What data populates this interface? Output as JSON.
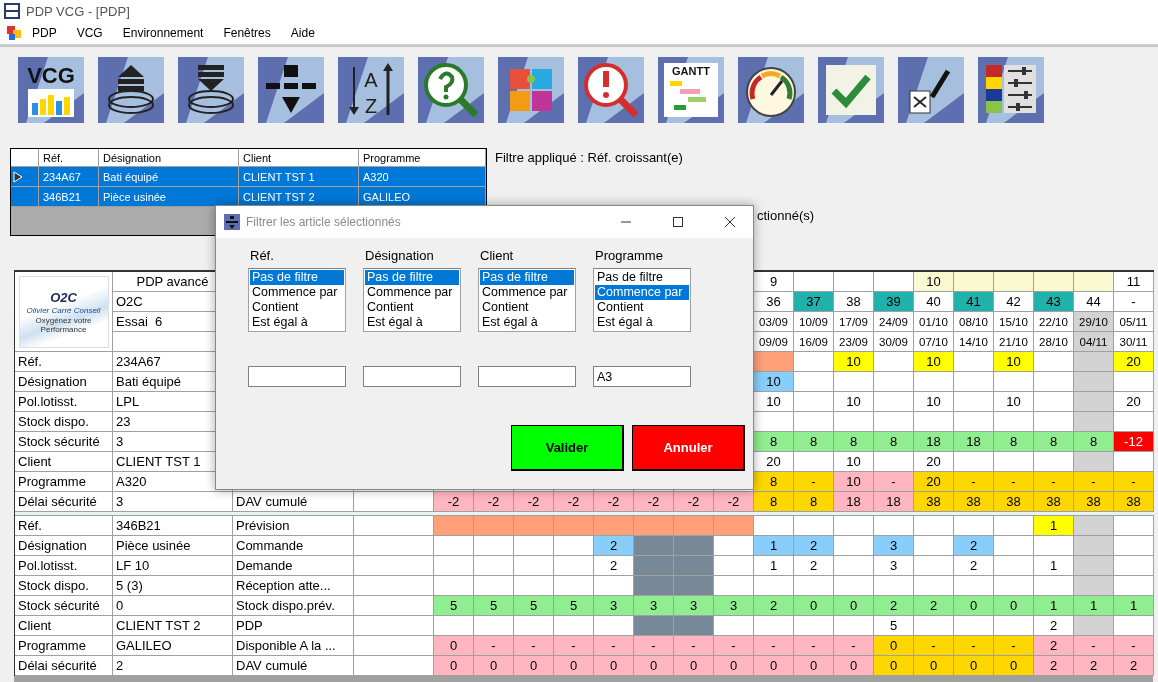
{
  "window": {
    "title": "PDP VCG - [PDP]"
  },
  "menu": [
    {
      "label": "PDP"
    },
    {
      "label": "VCG"
    },
    {
      "label": "Environnement"
    },
    {
      "label": "Fenêtres"
    },
    {
      "label": "Aide"
    }
  ],
  "toolbar": [
    {
      "kind": "vcg",
      "label": "VCG"
    },
    {
      "kind": "stack_up"
    },
    {
      "kind": "stack_down"
    },
    {
      "kind": "filter"
    },
    {
      "kind": "sort",
      "letters": [
        "A",
        "Z"
      ]
    },
    {
      "kind": "search_question"
    },
    {
      "kind": "puzzle"
    },
    {
      "kind": "search_alert"
    },
    {
      "kind": "gantt",
      "label": "GANTT"
    },
    {
      "kind": "gauge"
    },
    {
      "kind": "check"
    },
    {
      "kind": "excel"
    },
    {
      "kind": "settings"
    }
  ],
  "selection_table": {
    "columns": [
      "Réf.",
      "Désignation",
      "Client",
      "Programme"
    ],
    "rows": [
      {
        "cells": [
          "234A67",
          "Bati équipé",
          "CLIENT TST 1",
          "A320"
        ],
        "selected": true,
        "current": true
      },
      {
        "cells": [
          "346B21",
          "Pièce usinée",
          "CLIENT TST 2",
          "GALILEO"
        ],
        "selected": true,
        "current": false
      }
    ]
  },
  "filter_status": "Filtre appliqué : Réf. croissant(e)",
  "selection_count": "ctionné(s)",
  "planning": {
    "logo": {
      "mark": "O2C",
      "name": "Olivier Carré Conseil",
      "tagline": "Oxygénez votre Performance"
    },
    "header_values": [
      "PDP avancé",
      "O2C",
      "Essai  6"
    ],
    "period_rows": [
      [
        null,
        null,
        null,
        null,
        null,
        null,
        null,
        null,
        {
          "text": "9"
        },
        {},
        {},
        {},
        {
          "text": "10",
          "color": "#fafad2"
        },
        {
          "color": "#fafad2"
        },
        {
          "color": "#fafad2"
        },
        {
          "color": "#fafad2"
        },
        {
          "color": "#fafad2"
        },
        {
          "text": "11"
        }
      ],
      [
        null,
        null,
        null,
        null,
        null,
        null,
        null,
        null,
        {
          "text": "36"
        },
        {
          "text": "37",
          "color": "#20b2aa"
        },
        {
          "text": "38"
        },
        {
          "text": "39",
          "color": "#20b2aa"
        },
        {
          "text": "40"
        },
        {
          "text": "41",
          "color": "#20b2aa"
        },
        {
          "text": "42"
        },
        {
          "text": "43",
          "color": "#20b2aa"
        },
        {
          "text": "44"
        },
        {
          "text": "-"
        }
      ],
      [
        null,
        null,
        null,
        null,
        null,
        null,
        null,
        null,
        {
          "text": "03/09"
        },
        {
          "text": "10/09"
        },
        {
          "text": "17/09"
        },
        {
          "text": "24/09"
        },
        {
          "text": "01/10"
        },
        {
          "text": "08/10"
        },
        {
          "text": "15/10"
        },
        {
          "text": "22/10"
        },
        {
          "text": "29/10",
          "color": "#d3d3d3"
        },
        {
          "text": "05/11"
        }
      ],
      [
        null,
        null,
        null,
        null,
        null,
        null,
        null,
        null,
        {
          "text": "09/09"
        },
        {
          "text": "16/09"
        },
        {
          "text": "23/09"
        },
        {
          "text": "30/09"
        },
        {
          "text": "07/10"
        },
        {
          "text": "14/10"
        },
        {
          "text": "21/10"
        },
        {
          "text": "28/10"
        },
        {
          "text": "04/11",
          "color": "#d3d3d3"
        },
        {
          "text": "30/11"
        }
      ]
    ],
    "articles": [
      {
        "rows": [
          {
            "label": "Réf.",
            "value": "234A67",
            "cells": [
              null,
              null,
              null,
              null,
              null,
              null,
              null,
              null,
              {
                "color": "#ffa07a"
              },
              {},
              {
                "text": "10",
                "color": "#ffff00"
              },
              {},
              {
                "text": "10",
                "color": "#ffff00"
              },
              {},
              {
                "text": "10",
                "color": "#ffff00"
              },
              {},
              {
                "color": "#d3d3d3"
              },
              {
                "text": "20",
                "color": "#ffff00"
              }
            ]
          },
          {
            "label": "Désignation",
            "value": "Bati équipé",
            "cells": [
              null,
              null,
              null,
              null,
              null,
              null,
              null,
              null,
              {
                "text": "10",
                "color": "#87cefa"
              },
              {},
              {},
              {},
              {},
              {},
              {},
              {},
              {
                "color": "#d3d3d3"
              },
              {}
            ]
          },
          {
            "label": "Pol.lotisst.",
            "value": "LPL",
            "cells": [
              null,
              null,
              null,
              null,
              null,
              null,
              null,
              null,
              {
                "text": "10"
              },
              {},
              {
                "text": "10"
              },
              {},
              {
                "text": "10"
              },
              {},
              {
                "text": "10"
              },
              {},
              {
                "color": "#d3d3d3"
              },
              {
                "text": "20"
              }
            ]
          },
          {
            "label": "Stock dispo.",
            "value": "23",
            "cells": [
              null,
              null,
              null,
              null,
              null,
              null,
              null,
              null,
              {},
              {},
              {},
              {},
              {},
              {},
              {},
              {},
              {
                "color": "#d3d3d3"
              },
              {}
            ]
          },
          {
            "label": "Stock sécurité",
            "value": "3",
            "cells": [
              null,
              null,
              null,
              null,
              null,
              null,
              null,
              null,
              {
                "text": "8",
                "color": "#90ee90"
              },
              {
                "text": "8",
                "color": "#90ee90"
              },
              {
                "text": "8",
                "color": "#90ee90"
              },
              {
                "text": "8",
                "color": "#90ee90"
              },
              {
                "text": "18",
                "color": "#90ee90"
              },
              {
                "text": "18",
                "color": "#90ee90"
              },
              {
                "text": "8",
                "color": "#90ee90"
              },
              {
                "text": "8",
                "color": "#90ee90"
              },
              {
                "text": "8",
                "color": "#90ee90"
              },
              {
                "text": "-12",
                "color": "#ff0000"
              }
            ]
          },
          {
            "label": "Client",
            "value": "CLIENT TST 1",
            "cells": [
              null,
              null,
              null,
              null,
              null,
              null,
              null,
              null,
              {
                "text": "20"
              },
              {},
              {
                "text": "10"
              },
              {},
              {
                "text": "20"
              },
              {},
              {},
              {},
              {
                "color": "#d3d3d3"
              },
              {}
            ]
          },
          {
            "label": "Programme",
            "value": "A320",
            "cells": [
              null,
              null,
              null,
              null,
              null,
              null,
              null,
              null,
              {
                "text": "8",
                "color": "#ffd700"
              },
              {
                "text": "-",
                "color": "#ffd700"
              },
              {
                "text": "10",
                "color": "#ffb6c1"
              },
              {
                "text": "-",
                "color": "#ffb6c1"
              },
              {
                "text": "20",
                "color": "#ffd700"
              },
              {
                "text": "-",
                "color": "#ffd700"
              },
              {
                "text": "-",
                "color": "#ffd700"
              },
              {
                "text": "-",
                "color": "#ffd700"
              },
              {
                "text": "-",
                "color": "#ffd700"
              },
              {
                "text": "-",
                "color": "#ffd700"
              }
            ]
          },
          {
            "label": "Délai sécurité",
            "value": "3",
            "measure": "DAV cumulé",
            "cells": [
              {
                "text": "-2",
                "color": "#ffb6c1"
              },
              {
                "text": "-2",
                "color": "#ffb6c1"
              },
              {
                "text": "-2",
                "color": "#ffb6c1"
              },
              {
                "text": "-2",
                "color": "#ffb6c1"
              },
              {
                "text": "-2",
                "color": "#ffb6c1"
              },
              {
                "text": "-2",
                "color": "#ffb6c1"
              },
              {
                "text": "-2",
                "color": "#ffb6c1"
              },
              {
                "text": "-2",
                "color": "#ffb6c1"
              },
              {
                "text": "8",
                "color": "#ffd700"
              },
              {
                "text": "8",
                "color": "#ffd700"
              },
              {
                "text": "18",
                "color": "#ffb6c1"
              },
              {
                "text": "18",
                "color": "#ffb6c1"
              },
              {
                "text": "38",
                "color": "#ffd700"
              },
              {
                "text": "38",
                "color": "#ffd700"
              },
              {
                "text": "38",
                "color": "#ffd700"
              },
              {
                "text": "38",
                "color": "#ffd700"
              },
              {
                "text": "38",
                "color": "#ffd700"
              },
              {
                "text": "38",
                "color": "#ffd700"
              }
            ]
          }
        ]
      },
      {
        "rows": [
          {
            "label": "Réf.",
            "value": "346B21",
            "measure": "Prévision",
            "cells": [
              {
                "color": "#ffa07a"
              },
              {
                "color": "#ffa07a"
              },
              {
                "color": "#ffa07a"
              },
              {
                "color": "#ffa07a"
              },
              {
                "color": "#ffa07a"
              },
              {
                "color": "#ffa07a"
              },
              {
                "color": "#ffa07a"
              },
              {
                "color": "#ffa07a"
              },
              {},
              {},
              {},
              {},
              {},
              {},
              {},
              {
                "text": "1",
                "color": "#ffff00"
              },
              {
                "color": "#d3d3d3"
              },
              {}
            ]
          },
          {
            "label": "Désignation",
            "value": "Pièce usinée",
            "measure": "Commande",
            "cells": [
              {},
              {},
              {},
              {},
              {
                "text": "2",
                "color": "#87cefa"
              },
              {
                "color": "#778899"
              },
              {
                "color": "#778899"
              },
              {},
              {
                "text": "1",
                "color": "#87cefa"
              },
              {
                "text": "2",
                "color": "#87cefa"
              },
              {},
              {
                "text": "3",
                "color": "#87cefa"
              },
              {},
              {
                "text": "2",
                "color": "#87cefa"
              },
              {},
              {},
              {
                "color": "#d3d3d3"
              },
              {}
            ]
          },
          {
            "label": "Pol.lotisst.",
            "value": "LF 10",
            "measure": "Demande",
            "cells": [
              {},
              {},
              {},
              {},
              {
                "text": "2"
              },
              {
                "color": "#778899"
              },
              {
                "color": "#778899"
              },
              {},
              {
                "text": "1"
              },
              {
                "text": "2"
              },
              {},
              {
                "text": "3"
              },
              {},
              {
                "text": "2"
              },
              {},
              {
                "text": "1"
              },
              {
                "color": "#d3d3d3"
              },
              {}
            ]
          },
          {
            "label": "Stock dispo.",
            "value": "5 (3)",
            "measure": "Réception atte...",
            "cells": [
              {},
              {},
              {},
              {},
              {},
              {
                "color": "#778899"
              },
              {
                "color": "#778899"
              },
              {},
              {},
              {},
              {},
              {},
              {},
              {},
              {},
              {},
              {
                "color": "#d3d3d3"
              },
              {}
            ]
          },
          {
            "label": "Stock sécurité",
            "value": "0",
            "measure": "Stock dispo.prév.",
            "cells": [
              {
                "text": "5",
                "color": "#90ee90"
              },
              {
                "text": "5",
                "color": "#90ee90"
              },
              {
                "text": "5",
                "color": "#90ee90"
              },
              {
                "text": "5",
                "color": "#90ee90"
              },
              {
                "text": "3",
                "color": "#90ee90"
              },
              {
                "text": "3",
                "color": "#90ee90"
              },
              {
                "text": "3",
                "color": "#90ee90"
              },
              {
                "text": "3",
                "color": "#90ee90"
              },
              {
                "text": "2",
                "color": "#90ee90"
              },
              {
                "text": "0",
                "color": "#90ee90"
              },
              {
                "text": "0",
                "color": "#90ee90"
              },
              {
                "text": "2",
                "color": "#90ee90"
              },
              {
                "text": "2",
                "color": "#90ee90"
              },
              {
                "text": "0",
                "color": "#90ee90"
              },
              {
                "text": "0",
                "color": "#90ee90"
              },
              {
                "text": "1",
                "color": "#90ee90"
              },
              {
                "text": "1",
                "color": "#90ee90"
              },
              {
                "text": "1",
                "color": "#90ee90"
              }
            ]
          },
          {
            "label": "Client",
            "value": "CLIENT TST 2",
            "measure": "PDP",
            "cells": [
              {},
              {},
              {},
              {},
              {},
              {
                "color": "#778899"
              },
              {
                "color": "#778899"
              },
              {},
              {},
              {},
              {},
              {
                "text": "5"
              },
              {},
              {},
              {},
              {
                "text": "2"
              },
              {
                "color": "#d3d3d3"
              },
              {}
            ]
          },
          {
            "label": "Programme",
            "value": "GALILEO",
            "measure": "Disponible A la ...",
            "cells": [
              {
                "text": "0",
                "color": "#ffb6c1"
              },
              {
                "text": "-",
                "color": "#ffb6c1"
              },
              {
                "text": "-",
                "color": "#ffb6c1"
              },
              {
                "text": "-",
                "color": "#ffb6c1"
              },
              {
                "text": "-",
                "color": "#ffb6c1"
              },
              {
                "text": "-",
                "color": "#ffb6c1"
              },
              {
                "text": "-",
                "color": "#ffb6c1"
              },
              {
                "text": "-",
                "color": "#ffb6c1"
              },
              {
                "text": "-",
                "color": "#ffb6c1"
              },
              {
                "text": "-",
                "color": "#ffb6c1"
              },
              {
                "text": "-",
                "color": "#ffb6c1"
              },
              {
                "text": "0",
                "color": "#ffd700"
              },
              {
                "text": "-",
                "color": "#ffd700"
              },
              {
                "text": "-",
                "color": "#ffd700"
              },
              {
                "text": "-",
                "color": "#ffd700"
              },
              {
                "text": "2",
                "color": "#ffb6c1"
              },
              {
                "text": "-",
                "color": "#ffb6c1"
              },
              {
                "text": "-",
                "color": "#ffb6c1"
              }
            ]
          },
          {
            "label": "Délai sécurité",
            "value": "2",
            "measure": "DAV cumulé",
            "cells": [
              {
                "text": "0",
                "color": "#ffb6c1"
              },
              {
                "text": "0",
                "color": "#ffb6c1"
              },
              {
                "text": "0",
                "color": "#ffb6c1"
              },
              {
                "text": "0",
                "color": "#ffb6c1"
              },
              {
                "text": "0",
                "color": "#ffb6c1"
              },
              {
                "text": "0",
                "color": "#ffb6c1"
              },
              {
                "text": "0",
                "color": "#ffb6c1"
              },
              {
                "text": "0",
                "color": "#ffb6c1"
              },
              {
                "text": "0",
                "color": "#ffb6c1"
              },
              {
                "text": "0",
                "color": "#ffb6c1"
              },
              {
                "text": "0",
                "color": "#ffb6c1"
              },
              {
                "text": "0",
                "color": "#ffd700"
              },
              {
                "text": "0",
                "color": "#ffd700"
              },
              {
                "text": "0",
                "color": "#ffd700"
              },
              {
                "text": "0",
                "color": "#ffd700"
              },
              {
                "text": "2",
                "color": "#ffb6c1"
              },
              {
                "text": "2",
                "color": "#ffb6c1"
              },
              {
                "text": "2",
                "color": "#ffb6c1"
              }
            ]
          }
        ]
      }
    ]
  },
  "dialog": {
    "title": "Filtrer les article sélectionnés",
    "filters": [
      {
        "label": "Réf.",
        "options": [
          {
            "text": "Pas de filtre",
            "selected": true
          },
          {
            "text": "Commence par",
            "selected": false
          },
          {
            "text": "Contient",
            "selected": false
          },
          {
            "text": "Est égal à",
            "selected": false
          }
        ]
      },
      {
        "label": "Désignation",
        "options": [
          {
            "text": "Pas de filtre",
            "selected": true
          },
          {
            "text": "Commence par",
            "selected": false
          },
          {
            "text": "Contient",
            "selected": false
          },
          {
            "text": "Est égal à",
            "selected": false
          }
        ]
      },
      {
        "label": "Client",
        "options": [
          {
            "text": "Pas de filtre",
            "selected": true
          },
          {
            "text": "Commence par",
            "selected": false
          },
          {
            "text": "Contient",
            "selected": false
          },
          {
            "text": "Est égal à",
            "selected": false
          }
        ]
      },
      {
        "label": "Programme",
        "options": [
          {
            "text": "Pas de filtre",
            "selected": false
          },
          {
            "text": "Commence par",
            "selected": true
          },
          {
            "text": "Contient",
            "selected": false
          },
          {
            "text": "Est égal à",
            "selected": false
          }
        ],
        "value": "A3"
      }
    ],
    "buttons": [
      {
        "kind": "confirm",
        "label": "Valider"
      },
      {
        "kind": "cancel",
        "label": "Annuler"
      }
    ]
  }
}
